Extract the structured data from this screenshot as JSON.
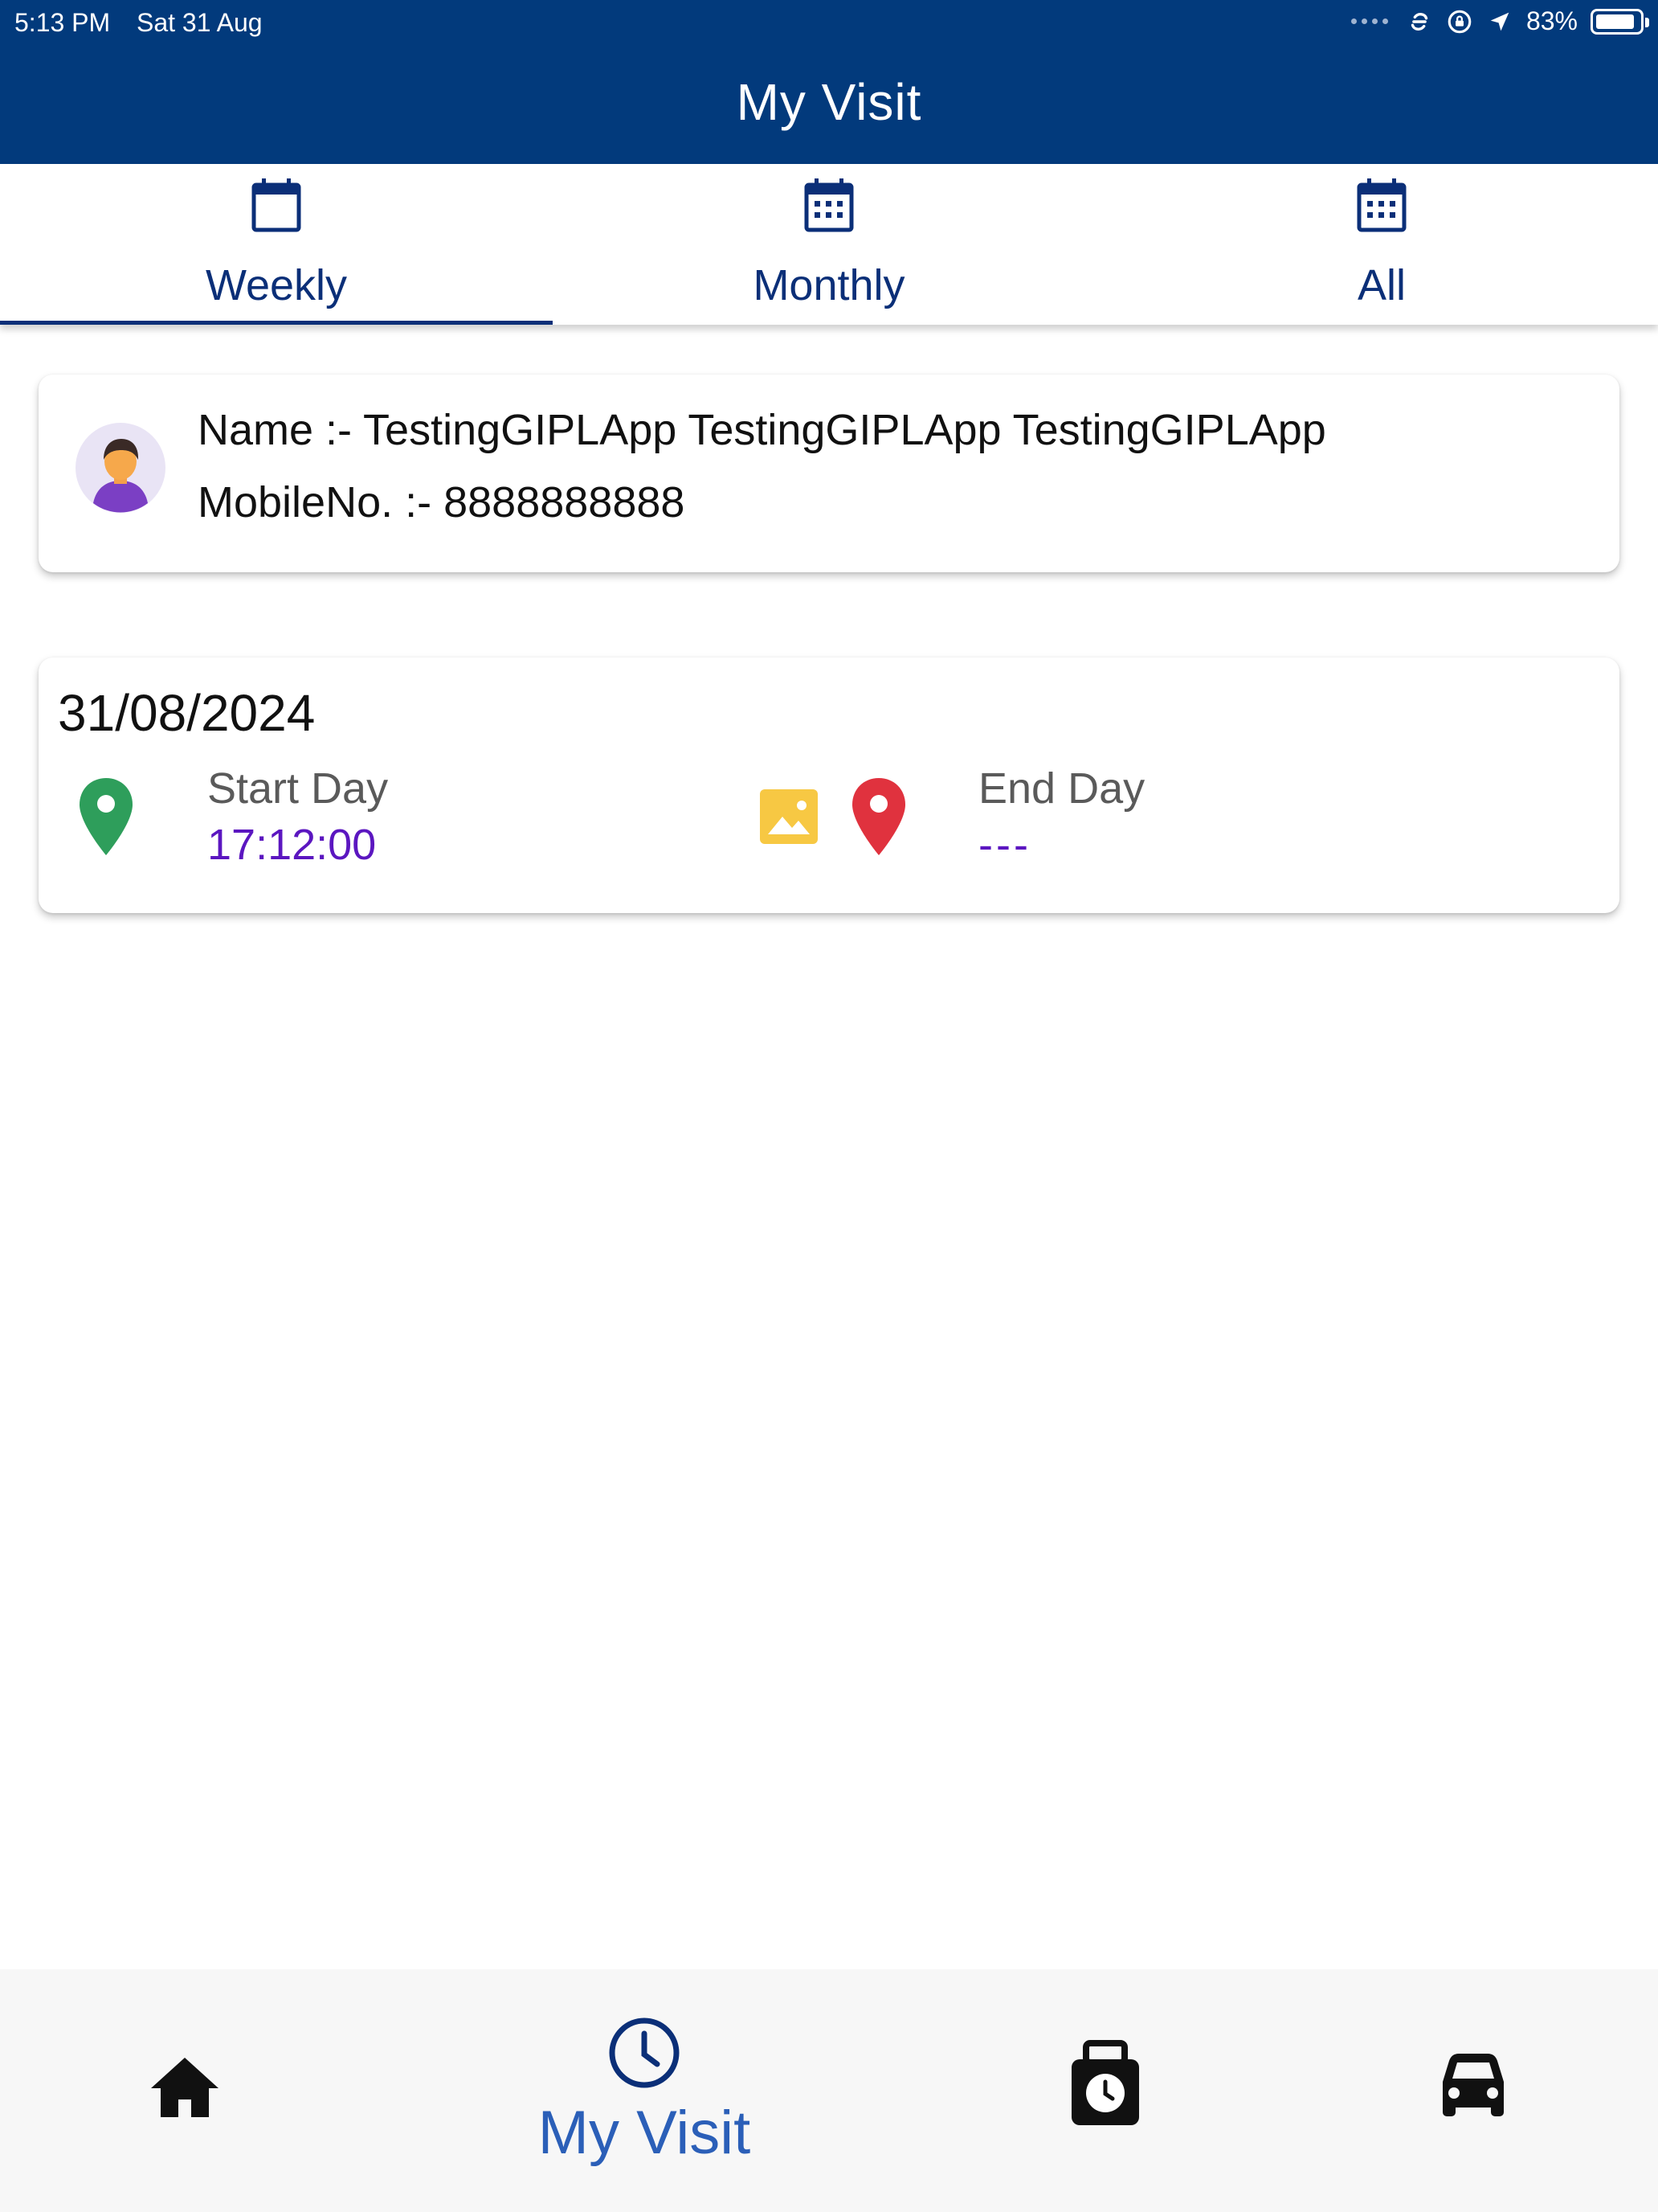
{
  "status_bar": {
    "time": "5:13 PM",
    "date": "Sat 31 Aug",
    "battery_percent": "83%",
    "battery_level": 0.83
  },
  "header": {
    "title": "My Visit"
  },
  "tabs": [
    {
      "label": "Weekly",
      "icon": "calendar-icon",
      "selected": true
    },
    {
      "label": "Monthly",
      "icon": "calendar-grid-icon",
      "selected": false
    },
    {
      "label": "All",
      "icon": "calendar-grid-icon",
      "selected": false
    }
  ],
  "profile": {
    "name_line": "Name :- TestingGIPLApp TestingGIPLApp TestingGIPLApp",
    "mobile_line": "MobileNo. :- 8888888888",
    "avatar_icon": "user-avatar"
  },
  "visit": {
    "date": "31/08/2024",
    "start_label": "Start Day",
    "start_value": "17:12:00",
    "end_label": "End Day",
    "end_value": "---",
    "colors": {
      "start_pin": "#2e9e5b",
      "end_pin": "#e0323e",
      "image_icon": "#f7c843",
      "value_text": "#5b16c0"
    }
  },
  "bottom_nav": {
    "items": [
      {
        "icon": "home-icon",
        "label": ""
      },
      {
        "icon": "clock-icon",
        "label": "My Visit",
        "selected": true
      },
      {
        "icon": "attendance-timer-icon",
        "label": ""
      },
      {
        "icon": "car-icon",
        "label": ""
      }
    ]
  },
  "theme": {
    "primary": "#023a7c",
    "tab_text": "#0b2f78",
    "nav_active": "#2b5fb8"
  }
}
